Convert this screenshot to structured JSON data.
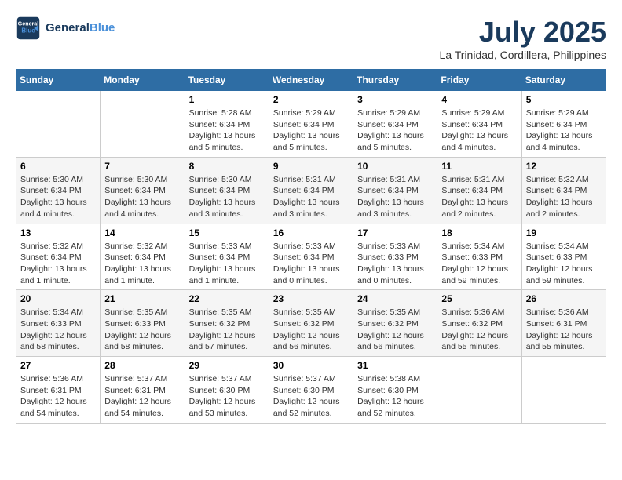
{
  "header": {
    "logo_line1": "General",
    "logo_line2": "Blue",
    "month": "July 2025",
    "location": "La Trinidad, Cordillera, Philippines"
  },
  "days_of_week": [
    "Sunday",
    "Monday",
    "Tuesday",
    "Wednesday",
    "Thursday",
    "Friday",
    "Saturday"
  ],
  "weeks": [
    [
      {
        "day": "",
        "info": ""
      },
      {
        "day": "",
        "info": ""
      },
      {
        "day": "1",
        "info": "Sunrise: 5:28 AM\nSunset: 6:34 PM\nDaylight: 13 hours and 5 minutes."
      },
      {
        "day": "2",
        "info": "Sunrise: 5:29 AM\nSunset: 6:34 PM\nDaylight: 13 hours and 5 minutes."
      },
      {
        "day": "3",
        "info": "Sunrise: 5:29 AM\nSunset: 6:34 PM\nDaylight: 13 hours and 5 minutes."
      },
      {
        "day": "4",
        "info": "Sunrise: 5:29 AM\nSunset: 6:34 PM\nDaylight: 13 hours and 4 minutes."
      },
      {
        "day": "5",
        "info": "Sunrise: 5:29 AM\nSunset: 6:34 PM\nDaylight: 13 hours and 4 minutes."
      }
    ],
    [
      {
        "day": "6",
        "info": "Sunrise: 5:30 AM\nSunset: 6:34 PM\nDaylight: 13 hours and 4 minutes."
      },
      {
        "day": "7",
        "info": "Sunrise: 5:30 AM\nSunset: 6:34 PM\nDaylight: 13 hours and 4 minutes."
      },
      {
        "day": "8",
        "info": "Sunrise: 5:30 AM\nSunset: 6:34 PM\nDaylight: 13 hours and 3 minutes."
      },
      {
        "day": "9",
        "info": "Sunrise: 5:31 AM\nSunset: 6:34 PM\nDaylight: 13 hours and 3 minutes."
      },
      {
        "day": "10",
        "info": "Sunrise: 5:31 AM\nSunset: 6:34 PM\nDaylight: 13 hours and 3 minutes."
      },
      {
        "day": "11",
        "info": "Sunrise: 5:31 AM\nSunset: 6:34 PM\nDaylight: 13 hours and 2 minutes."
      },
      {
        "day": "12",
        "info": "Sunrise: 5:32 AM\nSunset: 6:34 PM\nDaylight: 13 hours and 2 minutes."
      }
    ],
    [
      {
        "day": "13",
        "info": "Sunrise: 5:32 AM\nSunset: 6:34 PM\nDaylight: 13 hours and 1 minute."
      },
      {
        "day": "14",
        "info": "Sunrise: 5:32 AM\nSunset: 6:34 PM\nDaylight: 13 hours and 1 minute."
      },
      {
        "day": "15",
        "info": "Sunrise: 5:33 AM\nSunset: 6:34 PM\nDaylight: 13 hours and 1 minute."
      },
      {
        "day": "16",
        "info": "Sunrise: 5:33 AM\nSunset: 6:34 PM\nDaylight: 13 hours and 0 minutes."
      },
      {
        "day": "17",
        "info": "Sunrise: 5:33 AM\nSunset: 6:33 PM\nDaylight: 13 hours and 0 minutes."
      },
      {
        "day": "18",
        "info": "Sunrise: 5:34 AM\nSunset: 6:33 PM\nDaylight: 12 hours and 59 minutes."
      },
      {
        "day": "19",
        "info": "Sunrise: 5:34 AM\nSunset: 6:33 PM\nDaylight: 12 hours and 59 minutes."
      }
    ],
    [
      {
        "day": "20",
        "info": "Sunrise: 5:34 AM\nSunset: 6:33 PM\nDaylight: 12 hours and 58 minutes."
      },
      {
        "day": "21",
        "info": "Sunrise: 5:35 AM\nSunset: 6:33 PM\nDaylight: 12 hours and 58 minutes."
      },
      {
        "day": "22",
        "info": "Sunrise: 5:35 AM\nSunset: 6:32 PM\nDaylight: 12 hours and 57 minutes."
      },
      {
        "day": "23",
        "info": "Sunrise: 5:35 AM\nSunset: 6:32 PM\nDaylight: 12 hours and 56 minutes."
      },
      {
        "day": "24",
        "info": "Sunrise: 5:35 AM\nSunset: 6:32 PM\nDaylight: 12 hours and 56 minutes."
      },
      {
        "day": "25",
        "info": "Sunrise: 5:36 AM\nSunset: 6:32 PM\nDaylight: 12 hours and 55 minutes."
      },
      {
        "day": "26",
        "info": "Sunrise: 5:36 AM\nSunset: 6:31 PM\nDaylight: 12 hours and 55 minutes."
      }
    ],
    [
      {
        "day": "27",
        "info": "Sunrise: 5:36 AM\nSunset: 6:31 PM\nDaylight: 12 hours and 54 minutes."
      },
      {
        "day": "28",
        "info": "Sunrise: 5:37 AM\nSunset: 6:31 PM\nDaylight: 12 hours and 54 minutes."
      },
      {
        "day": "29",
        "info": "Sunrise: 5:37 AM\nSunset: 6:30 PM\nDaylight: 12 hours and 53 minutes."
      },
      {
        "day": "30",
        "info": "Sunrise: 5:37 AM\nSunset: 6:30 PM\nDaylight: 12 hours and 52 minutes."
      },
      {
        "day": "31",
        "info": "Sunrise: 5:38 AM\nSunset: 6:30 PM\nDaylight: 12 hours and 52 minutes."
      },
      {
        "day": "",
        "info": ""
      },
      {
        "day": "",
        "info": ""
      }
    ]
  ]
}
